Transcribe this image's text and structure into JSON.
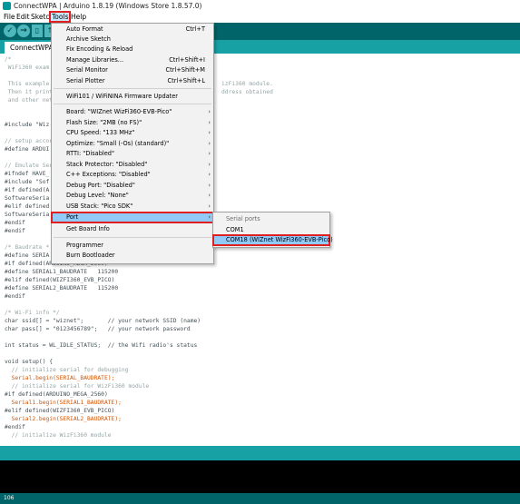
{
  "window": {
    "title": "ConnectWPA | Arduino 1.8.19 (Windows Store 1.8.57.0)"
  },
  "menubar": [
    {
      "label": "File"
    },
    {
      "label": "Edit"
    },
    {
      "label": "Sketch"
    },
    {
      "label": "Tools",
      "active": true
    },
    {
      "label": "Help"
    }
  ],
  "toolbar": {
    "verify_icon": "check-icon",
    "upload_icon": "arrow-right-icon",
    "new_icon": "new-file-icon",
    "open_icon": "arrow-up-icon",
    "save_icon": "arrow-down-icon"
  },
  "tab": {
    "label": "ConnectWPA"
  },
  "code": [
    "/*",
    " WiFi360 exam",
    "",
    " This example",
    " Then it print",
    " and other net",
    "",
    "#include \"Wiz",
    "",
    "// setup accor",
    "#define ARDUI",
    "",
    "// Emulate Ser",
    "#ifndef HAVE_",
    "#include \"Sof",
    "#if defined(A",
    "SoftwareSeria",
    "#elif defined",
    "SoftwareSeria",
    "#endif",
    "#endif",
    "",
    "/* Baudrate *",
    "#define SERIA",
    "#if defined(ARDUINO_MEGA_2560)",
    "#define SERIAL1_BAUDRATE   115200",
    "#elif defined(WIZFI360_EVB_PICO)",
    "#define SERIAL2_BAUDRATE   115200",
    "#endif",
    "",
    "/* Wi-Fi info */",
    "char ssid[] = \"wiznet\";       // your network SSID (name)",
    "char pass[] = \"0123456789\";   // your network password",
    "",
    "int status = WL_IDLE_STATUS;  // the Wifi radio's status",
    "",
    "void setup() {",
    "  // initialize serial for debugging",
    "  Serial.begin(SERIAL_BAUDRATE);",
    "  // initialize serial for WizFi360 module",
    "#if defined(ARDUINO_MEGA_2560)",
    "  Serial1.begin(SERIAL1_BAUDRATE);",
    "#elif defined(WIZFI360_EVB_PICO)",
    "  Serial2.begin(SERIAL2_BAUDRATE);",
    "#endif",
    "  // initialize WizFi360 module"
  ],
  "code_right_fragments": {
    "line4": "izFi360 module.",
    "line5": "ddress obtained"
  },
  "tools_menu": {
    "items": [
      {
        "label": "Auto Format",
        "shortcut": "Ctrl+T"
      },
      {
        "label": "Archive Sketch"
      },
      {
        "label": "Fix Encoding & Reload"
      },
      {
        "label": "Manage Libraries...",
        "shortcut": "Ctrl+Shift+I"
      },
      {
        "label": "Serial Monitor",
        "shortcut": "Ctrl+Shift+M"
      },
      {
        "label": "Serial Plotter",
        "shortcut": "Ctrl+Shift+L"
      },
      {
        "label": "WiFi101 / WiFiNINA Firmware Updater"
      },
      {
        "label": "Board: \"WIZnet WizFi360-EVB-Pico\"",
        "submenu": true
      },
      {
        "label": "Flash Size: \"2MB (no FS)\"",
        "submenu": true
      },
      {
        "label": "CPU Speed: \"133 MHz\"",
        "submenu": true
      },
      {
        "label": "Optimize: \"Small (-Os) (standard)\"",
        "submenu": true
      },
      {
        "label": "RTTI: \"Disabled\"",
        "submenu": true
      },
      {
        "label": "Stack Protector: \"Disabled\"",
        "submenu": true
      },
      {
        "label": "C++ Exceptions: \"Disabled\"",
        "submenu": true
      },
      {
        "label": "Debug Port: \"Disabled\"",
        "submenu": true
      },
      {
        "label": "Debug Level: \"None\"",
        "submenu": true
      },
      {
        "label": "USB Stack: \"Pico SDK\"",
        "submenu": true
      },
      {
        "label": "Port",
        "submenu": true,
        "highlighted": true
      },
      {
        "label": "Get Board Info"
      },
      {
        "label": "Programmer"
      },
      {
        "label": "Burn Bootloader"
      }
    ],
    "arrow": "›"
  },
  "port_submenu": {
    "header": "Serial ports",
    "items": [
      {
        "label": "COM1"
      },
      {
        "label": "COM18 (WIZnet WizFi360-EVB-Pico)",
        "highlighted": true
      }
    ]
  },
  "statusbar": {
    "line_number": "106"
  },
  "colors": {
    "toolbar": "#006468",
    "tabbar": "#17a1a5",
    "highlight": "#91c9f7",
    "annotation": "#e02020"
  }
}
